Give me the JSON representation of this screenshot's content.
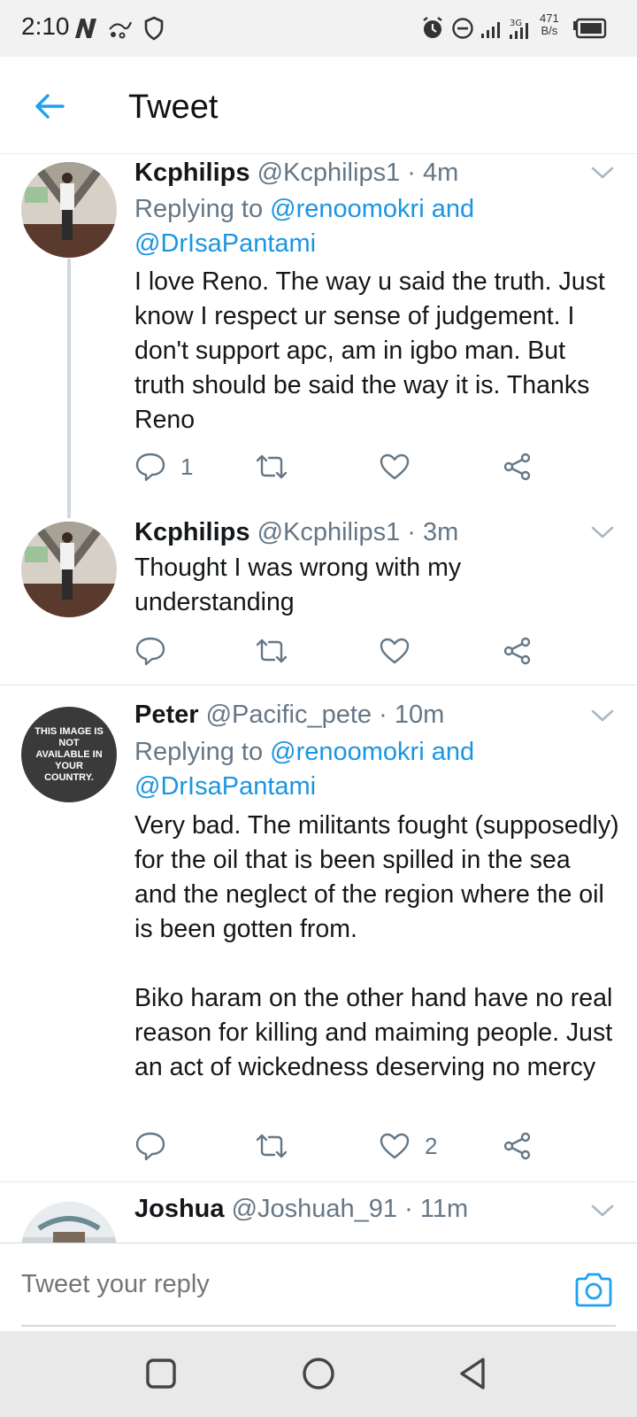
{
  "status_bar": {
    "time": "2:10",
    "net_speed_value": "471",
    "net_speed_unit": "B/s",
    "icons": [
      "netflix-icon",
      "messenger-icon",
      "shield-icon",
      "alarm-icon",
      "dnd-icon",
      "signal-icon",
      "3g-signal-icon",
      "battery-icon"
    ]
  },
  "header": {
    "title": "Tweet"
  },
  "tweets": [
    {
      "name": "Kcphilips",
      "handle": "@Kcphilips1",
      "time": "· 4m",
      "replying_prefix": "Replying to",
      "replying_mention_1": "@renoomokri",
      "replying_and": "and",
      "replying_mention_2": "@DrIsaPantami",
      "text": "I love Reno. The way u said the truth. Just know I respect ur sense of judgement.  I don't support apc, am in igbo man. But truth should be said the way it is. Thanks Reno",
      "reply_count": "1",
      "retweet_count": "",
      "like_count": ""
    },
    {
      "name": "Kcphilips",
      "handle": "@Kcphilips1",
      "time": "· 3m",
      "text": "Thought I was wrong with my understanding",
      "reply_count": "",
      "retweet_count": "",
      "like_count": ""
    },
    {
      "name": "Peter",
      "handle": "@Pacific_pete",
      "time": "· 10m",
      "replying_prefix": "Replying to",
      "replying_mention_1": "@renoomokri",
      "replying_and": "and",
      "replying_mention_2": "@DrIsaPantami",
      "avatar_text": "THIS IMAGE IS NOT AVAILABLE IN YOUR COUNTRY.",
      "text": "Very bad. The militants fought (supposedly) for the oil that is been spilled in the sea and the neglect of the region where the oil is been gotten from.\n\nBiko haram on the other hand have no real reason for killing and maiming people. Just an act of wickedness deserving no mercy",
      "reply_count": "",
      "retweet_count": "",
      "like_count": "2"
    },
    {
      "name": "Joshua",
      "handle": "@Joshuah_91",
      "time": "· 11m"
    }
  ],
  "reply_bar": {
    "placeholder": "Tweet your reply"
  },
  "colors": {
    "accent": "#1da1f2",
    "mention": "#1b95e0",
    "meta_gray": "#657786",
    "status_bar_bg": "#f2f2f2",
    "nav_bar_bg": "#e9e9e9"
  }
}
